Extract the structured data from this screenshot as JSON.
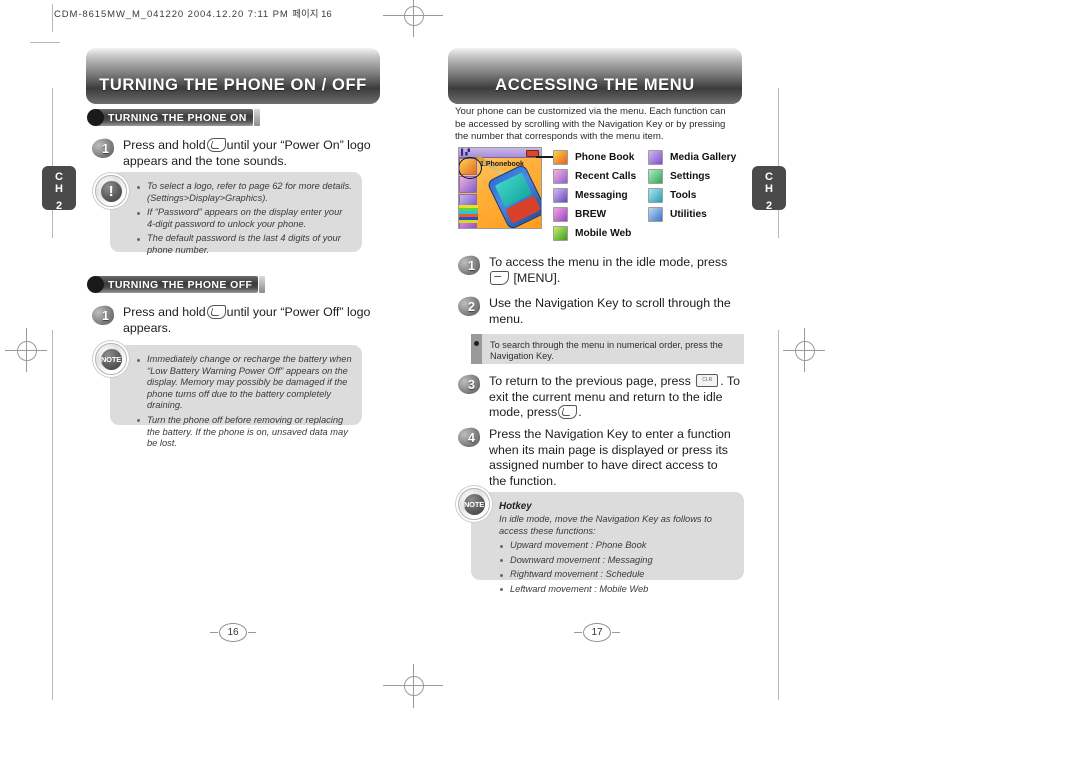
{
  "header": {
    "filename_line": "CDM-8615MW_M_041220  2004.12.20  7:11 PM",
    "korean_suffix": "페이지 16"
  },
  "left_page": {
    "chapter_tab": {
      "line1": "C",
      "line2": "H",
      "number": "2"
    },
    "banner_title": "TURNING THE PHONE ON / OFF",
    "page_number": "16",
    "sections": [
      {
        "heading": "TURNING THE PHONE ON",
        "steps": [
          {
            "number": "1",
            "text_before": "Press and hold",
            "key_icon": "end-send-key-icon",
            "text_after": "until your “Power On” logo appears and the tone sounds."
          }
        ],
        "note": {
          "icon": "exclamation-note-icon",
          "bullets": [
            "To select a logo, refer to page 62 for more details. (Settings>Display>Graphics).",
            "If “Password” appears on the display enter your 4-digit password to unlock your phone.",
            "The default password is the last 4 digits of your phone number."
          ]
        }
      },
      {
        "heading": "TURNING THE PHONE OFF",
        "steps": [
          {
            "number": "1",
            "text_before": "Press and hold",
            "key_icon": "end-send-key-icon",
            "text_after": "until your “Power Off” logo appears."
          }
        ],
        "note": {
          "icon": "note-icon",
          "bullets": [
            "Immediately change or recharge the battery when “Low Battery Warning Power Off” appears on the display. Memory may possibly be damaged if the phone turns off due to the battery completely draining.",
            "Turn the phone off before removing or replacing the battery. If the phone is on, unsaved data may be lost."
          ]
        }
      }
    ]
  },
  "right_page": {
    "chapter_tab": {
      "line1": "C",
      "line2": "H",
      "number": "2"
    },
    "banner_title": "ACCESSING THE MENU",
    "page_number": "17",
    "intro": "Your phone can be customized via the menu. Each function can be accessed by scrolling with the Navigation Key or by pressing the number that corresponds with the menu item.",
    "phone_screen": {
      "selected_label": "1.Phonebook",
      "status_icons": [
        "signal-icon",
        "battery-icon"
      ]
    },
    "menu_columns": [
      {
        "items": [
          {
            "label": "Phone Book",
            "icon": "phonebook-icon",
            "color": "#f2a93b"
          },
          {
            "label": "Recent Calls",
            "icon": "recent-calls-icon",
            "color": "#f2a1c8"
          },
          {
            "label": "Messaging",
            "icon": "messaging-icon",
            "color": "#b9a7e8"
          },
          {
            "label": "BREW",
            "icon": "brew-icon",
            "color": "#e58fd6"
          },
          {
            "label": "Mobile Web",
            "icon": "mobile-web-icon",
            "color": "#a9e06a"
          }
        ]
      },
      {
        "items": [
          {
            "label": "Media Gallery",
            "icon": "media-gallery-icon",
            "color": "#bda6e8"
          },
          {
            "label": "Settings",
            "icon": "settings-icon",
            "color": "#8fe0a8"
          },
          {
            "label": "Tools",
            "icon": "tools-icon",
            "color": "#8fd9e8"
          },
          {
            "label": "Utilities",
            "icon": "utilities-icon",
            "color": "#9fc8ef"
          }
        ]
      }
    ],
    "steps": [
      {
        "number": "1",
        "text_before": "To access the menu in the idle mode, press",
        "key_icon": "menu-key-icon",
        "text_after": "[MENU]."
      },
      {
        "number": "2",
        "text_before": "Use the Navigation Key to scroll through the menu.",
        "key_icon": "",
        "text_after": ""
      },
      {
        "number": "3",
        "text_before": "To return to the previous page, press",
        "key_icon": "clear-key-icon",
        "text_mid": ". To exit the current menu and return to the idle mode, press",
        "key_icon2": "end-send-key-icon",
        "text_after": "."
      },
      {
        "number": "4",
        "text_before": "Press the Navigation Key to enter a function when its main page is displayed or press its assigned number to have direct access to the function.",
        "key_icon": "",
        "text_after": ""
      }
    ],
    "tip": "To search through the menu in numerical order, press the Navigation Key.",
    "hotkey_note": {
      "icon": "note-icon",
      "title": "Hotkey",
      "intro": "In idle mode, move the Navigation Key as follows to access these functions:",
      "bullets": [
        "Upward movement : Phone Book",
        "Downward movement : Messaging",
        "Rightward movement : Schedule",
        "Leftward movement : Mobile Web"
      ]
    }
  }
}
